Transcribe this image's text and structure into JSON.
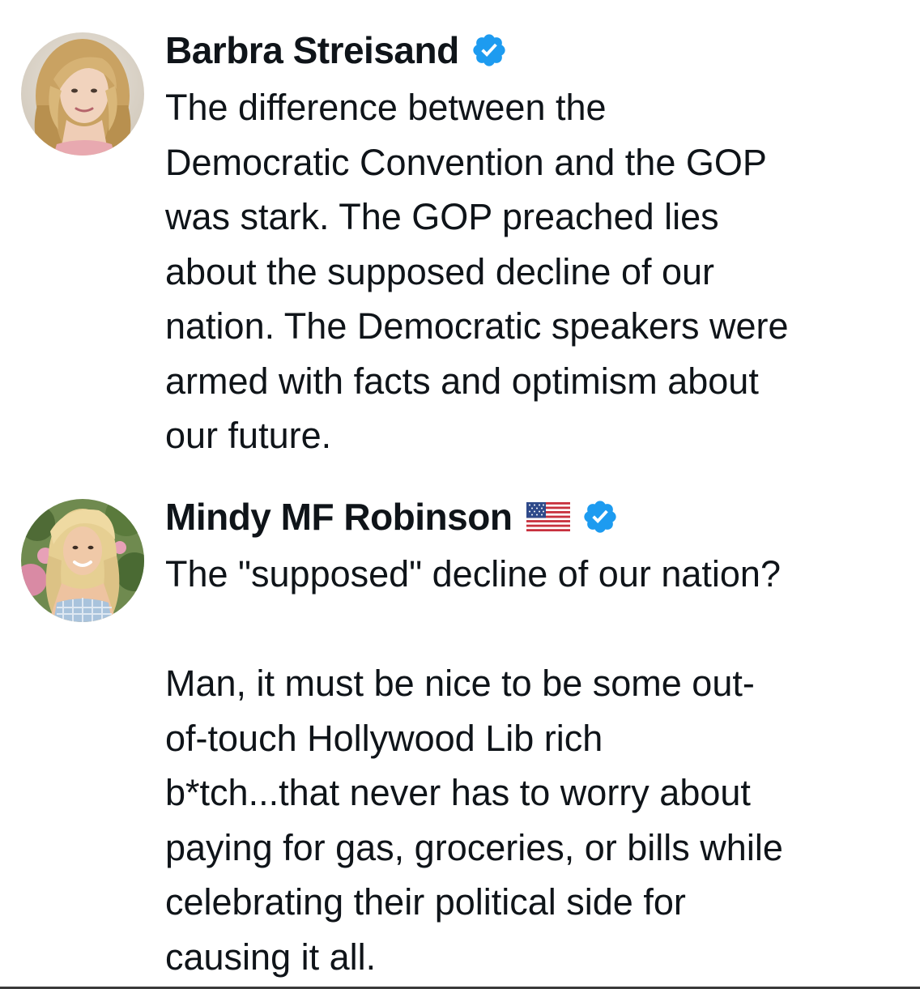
{
  "tweets": [
    {
      "author": {
        "display_name": "Barbra Streisand",
        "verified": true,
        "avatar_icon": "profile-photo"
      },
      "text": "The difference between the\nDemocratic Convention and the GOP\nwas stark. The GOP preached lies\nabout the supposed decline of our\nnation. The Democratic speakers were\narmed with facts and optimism about\nour future."
    },
    {
      "author": {
        "display_name": "Mindy MF Robinson",
        "flag_emoji": "us-flag",
        "verified": true,
        "avatar_icon": "profile-photo"
      },
      "text": "The \"supposed\" decline of our nation?\n\nMan, it must be nice to be some out-\nof-touch Hollywood Lib rich\nb*tch...that never has to worry about\npaying for gas, groceries, or bills while\ncelebrating their political side for\ncausing it all."
    }
  ],
  "colors": {
    "text": "#0f1419",
    "verified_blue": "#1d9bf0",
    "background": "#ffffff"
  }
}
